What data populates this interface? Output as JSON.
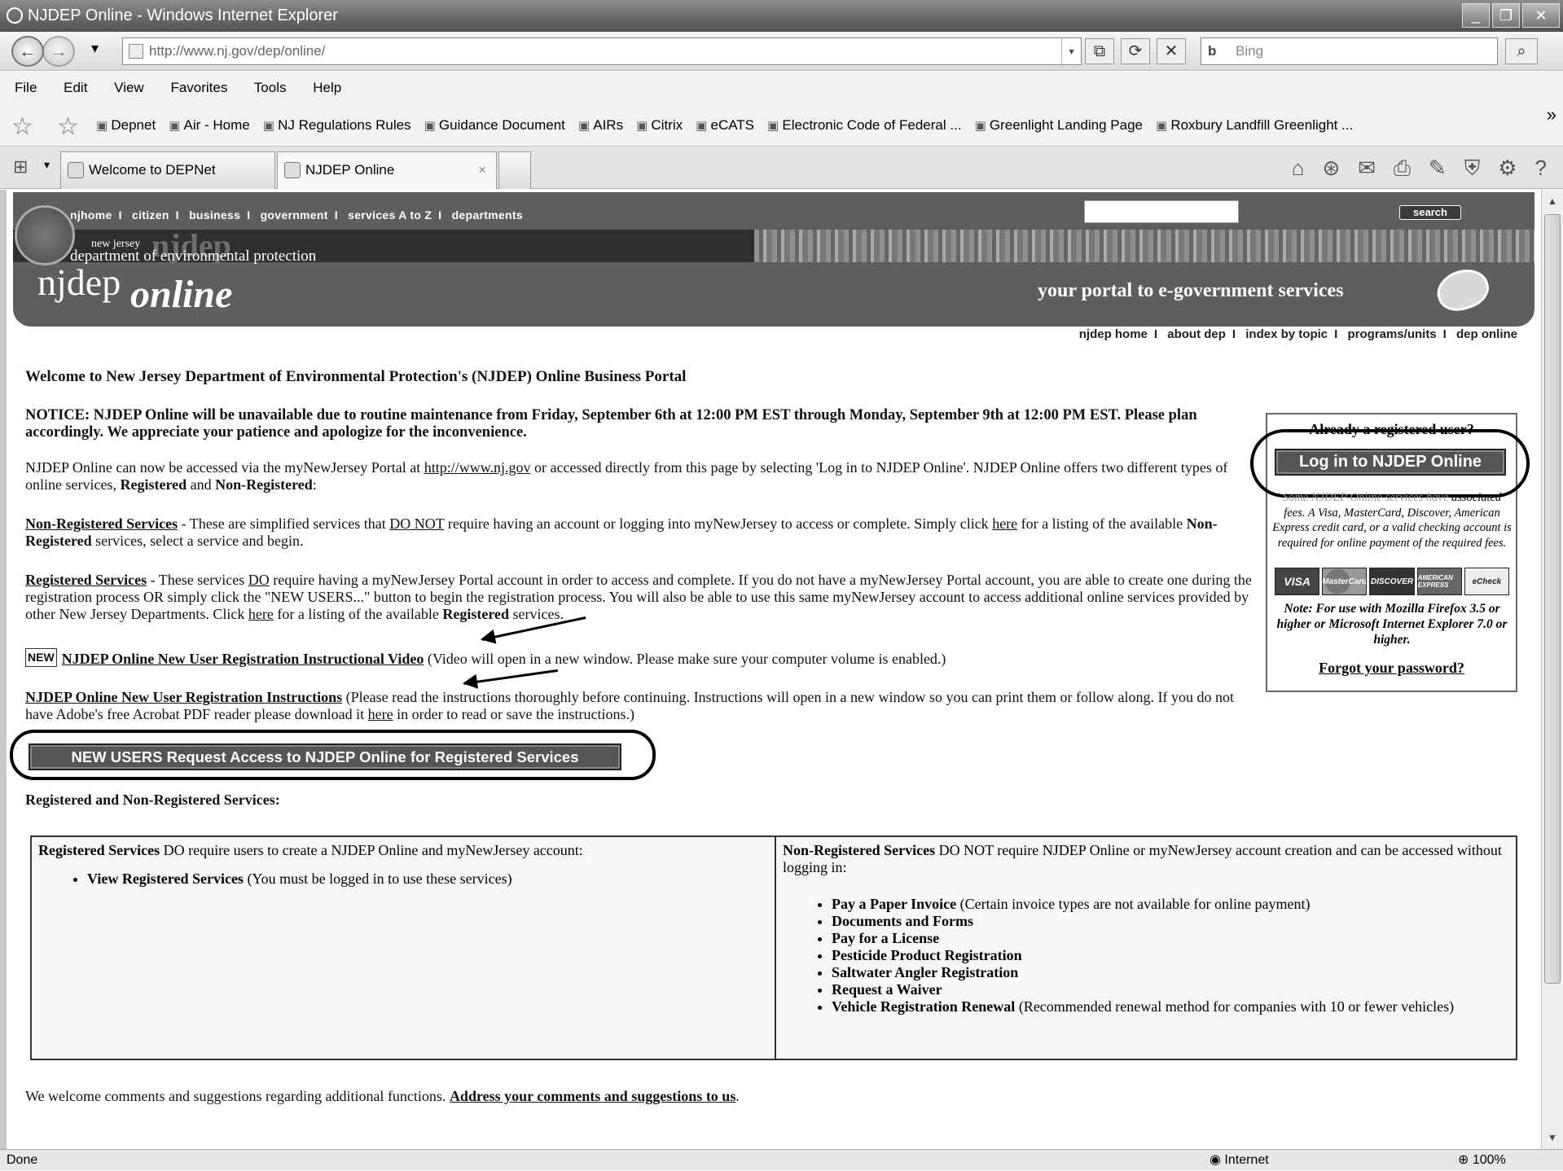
{
  "window": {
    "title": "NJDEP Online - Windows Internet Explorer",
    "min": "_",
    "max": "❐",
    "close": "✕"
  },
  "nav": {
    "back": "←",
    "forward": "→",
    "dropdown": "▾",
    "address": "http://www.nj.gov/dep/online/",
    "compat": "⧉",
    "refresh": "⟳",
    "stop": "✕",
    "search_placeholder": "Bing",
    "search_logo": "b",
    "search_go": "⌕"
  },
  "menu": [
    "File",
    "Edit",
    "View",
    "Favorites",
    "Tools",
    "Help"
  ],
  "favorites": [
    "Depnet",
    "Air - Home",
    "NJ Regulations Rules",
    "Guidance Document",
    "AIRs",
    "Citrix",
    "eCATS",
    "Electronic Code of Federal ...",
    "Greenlight Landing Page",
    "Roxbury Landfill Greenlight ..."
  ],
  "favorites_more": "»",
  "tabs": [
    {
      "label": "Welcome to DEPNet"
    },
    {
      "label": "NJDEP Online",
      "close": "×"
    }
  ],
  "command_icons": [
    "⌂",
    "⊛",
    "✉",
    "⎙",
    "✎",
    "⛨",
    "⚙",
    "?"
  ],
  "site": {
    "topnav": [
      "njhome",
      "citizen",
      "business",
      "government",
      "services A to Z",
      "departments"
    ],
    "topnav_sep": "I",
    "search_button": "search",
    "brand_newjersey": "new jersey",
    "brand_njdep_faint": "njdep",
    "brand_dep": "department of environmental protection",
    "logo_njdep": "njdep",
    "logo_online": "online",
    "tagline": "your portal to e-government services",
    "subnav": [
      "njdep home",
      "about dep",
      "index by topic",
      "programs/units",
      "dep online"
    ]
  },
  "content": {
    "welcome": "Welcome to New Jersey Department of Environmental Protection's (NJDEP) Online Business Portal",
    "notice": "NOTICE: NJDEP Online will be unavailable due to routine maintenance from Friday, September 6th at 12:00 PM EST through Monday, September 9th at 12:00 PM EST. Please plan accordingly. We appreciate your patience and apologize for the inconvenience.",
    "access_1": "NJDEP Online can now be accessed via the myNewJersey Portal at ",
    "access_link": "http://www.nj.gov",
    "access_2": " or accessed directly from this page by selecting 'Log in to NJDEP Online'. NJDEP Online offers two different types of online services, ",
    "access_reg": "Registered",
    "access_and": " and ",
    "access_nonreg": "Non-Registered",
    "access_end": ":",
    "nonreg_title": "Non-Registered Services",
    "nonreg_1": " - These are simplified services that ",
    "nonreg_donot": "DO NOT",
    "nonreg_2": " require having an account or logging into myNewJersey to access or complete. Simply click ",
    "nonreg_here": "here",
    "nonreg_3": " for a listing of the available ",
    "nonreg_bold": "Non-Registered",
    "nonreg_4": " services, select a service and begin.",
    "reg_title": "Registered Services",
    "reg_1": " - These services ",
    "reg_do": "DO",
    "reg_2": " require having a myNewJersey Portal account in order to access and complete. If you do not have a myNewJersey Portal account, you are able to create one during the registration process OR simply click the \"NEW USERS...\" button to begin the registration process. You will also be able to use this same myNewJersey account to access additional online services provided by other New Jersey Departments. Click ",
    "reg_here": "here",
    "reg_3": " for a listing of the available ",
    "reg_bold": "Registered",
    "reg_4": " services.",
    "new_badge": "NEW",
    "video_link": "NJDEP Online New User Registration Instructional Video",
    "video_note": " (Video will open in a new window. Please make sure your computer volume is enabled.)",
    "instr_link": "NJDEP Online New User Registration Instructions",
    "instr_1": " (Please read the instructions thoroughly before continuing. Instructions will open in a new window so you can print them or follow along. If you do not have Adobe's free Acrobat PDF reader please download it ",
    "instr_here": "here",
    "instr_2": " in order to read or save the instructions.)",
    "new_users_button": "NEW USERS Request Access to NJDEP Online for Registered Services",
    "services_heading": "Registered and Non-Registered Services:",
    "reg_col_1": "Registered Services ",
    "reg_col_do": "DO",
    "reg_col_2": " require users to create a NJDEP Online and myNewJersey account:",
    "reg_col_link": "View Registered Services",
    "reg_col_note": " (You must be logged in to use these services)",
    "nonreg_col_1": "Non-Registered Services ",
    "nonreg_col_donot": "DO NOT",
    "nonreg_col_2": " require NJDEP Online or myNewJersey account creation and can be accessed without logging in:",
    "nonreg_items": [
      {
        "link": "Pay a Paper Invoice",
        "note": " (Certain invoice types are not available for online payment)"
      },
      {
        "link": "Documents and Forms",
        "note": ""
      },
      {
        "link": "Pay for a License",
        "note": ""
      },
      {
        "link": "Pesticide Product Registration",
        "note": ""
      },
      {
        "link": "Saltwater Angler Registration",
        "note": ""
      },
      {
        "link": "Request a Waiver",
        "note": ""
      },
      {
        "link": "Vehicle Registration Renewal",
        "note": " (Recommended renewal method for companies with 10 or fewer vehicles)"
      }
    ],
    "comments_1": "We welcome comments and suggestions regarding additional functions. ",
    "comments_link": "Address your comments and suggestions to us",
    "comments_end": "."
  },
  "login": {
    "already": "Already a registered user?",
    "button": "Log in to NJDEP Online",
    "fees_lead": "Some NJDEP Online services have",
    "fees": "associated fees. A Visa, MasterCard, Discover, American Express credit card, or a valid checking account is required for online payment of the required fees.",
    "cards": [
      "VISA",
      "MasterCard",
      "DISCOVER",
      "AMERICAN EXPRESS",
      "eCheck"
    ],
    "note": "Note: For use with Mozilla Firefox 3.5 or higher or Microsoft Internet Explorer 7.0 or higher.",
    "forgot": "Forgot your password?"
  },
  "status": {
    "text": "Done",
    "zone": "Internet",
    "zoom": "100%"
  }
}
